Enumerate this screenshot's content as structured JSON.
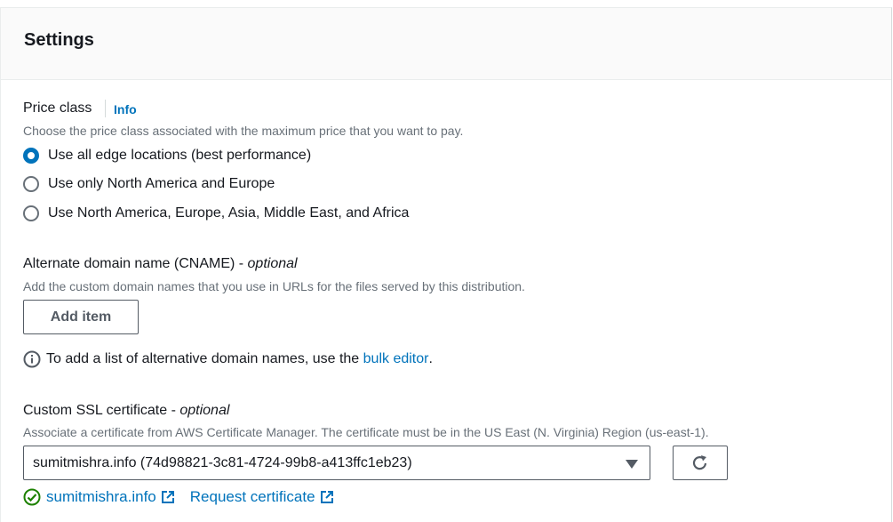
{
  "header": {
    "title": "Settings"
  },
  "price_class": {
    "label": "Price class",
    "info": "Info",
    "description": "Choose the price class associated with the maximum price that you want to pay.",
    "options": [
      {
        "label": "Use all edge locations (best performance)",
        "selected": true
      },
      {
        "label": "Use only North America and Europe",
        "selected": false
      },
      {
        "label": "Use North America, Europe, Asia, Middle East, and Africa",
        "selected": false
      }
    ]
  },
  "cname": {
    "label": "Alternate domain name (CNAME) - ",
    "optional": "optional",
    "description": "Add the custom domain names that you use in URLs for the files served by this distribution.",
    "add_button": "Add item",
    "info_text": "To add a list of alternative domain names, use the ",
    "info_link": "bulk editor",
    "info_end": "."
  },
  "ssl": {
    "label": "Custom SSL certificate - ",
    "optional": "optional",
    "description": "Associate a certificate from AWS Certificate Manager. The certificate must be in the US East (N. Virginia) Region (us-east-1).",
    "selected": "sumitmishra.info (74d98821-3c81-4724-99b8-a413ffc1eb23)",
    "status_link": "sumitmishra.info",
    "request_link": "Request certificate"
  },
  "colors": {
    "link": "#0073bb",
    "success": "#1d8102",
    "radio_selected": "#0073bb"
  }
}
